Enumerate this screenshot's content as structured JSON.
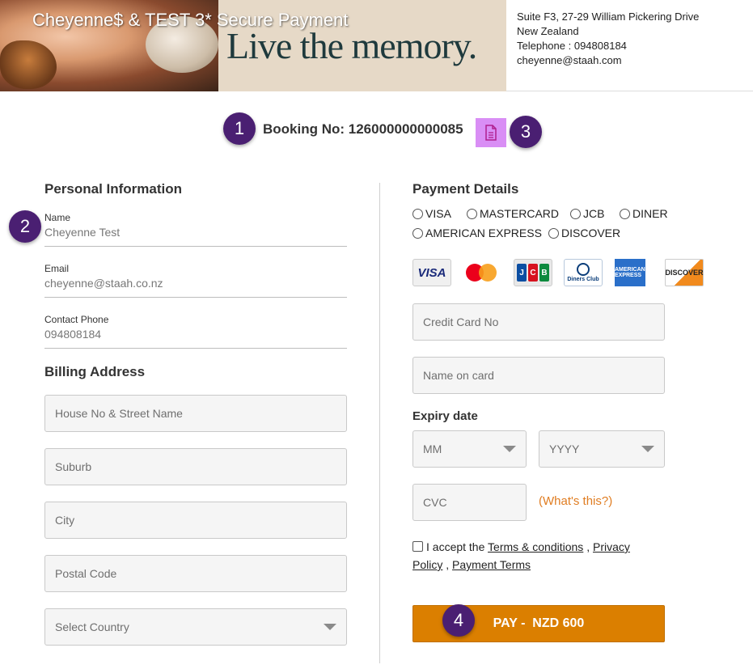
{
  "header": {
    "banner_title": "Cheyenne$ & TEST 3* Secure Payment",
    "banner_tagline": "Live the memory.",
    "address_line1": "Suite F3, 27-29 William Pickering Drive",
    "address_line2": "New Zealand",
    "telephone": "Telephone : 094808184",
    "email": "cheyenne@staah.com"
  },
  "booking": {
    "label": "Booking No: 126000000000085"
  },
  "markers": [
    "1",
    "2",
    "3",
    "4"
  ],
  "personal": {
    "title": "Personal Information",
    "name_label": "Name",
    "name_value": "Cheyenne Test",
    "email_label": "Email",
    "email_value": "cheyenne@staah.co.nz",
    "phone_label": "Contact Phone",
    "phone_value": "094808184"
  },
  "billing": {
    "title": "Billing Address",
    "street_placeholder": "House No & Street Name",
    "suburb_placeholder": "Suburb",
    "city_placeholder": "City",
    "postal_placeholder": "Postal Code",
    "country_placeholder": "Select Country"
  },
  "payment": {
    "title": "Payment Details",
    "card_types": [
      "VISA",
      "MASTERCARD",
      "JCB",
      "DINER",
      "AMERICAN EXPRESS",
      "DISCOVER"
    ],
    "logos": {
      "visa": "VISA",
      "jcb": [
        "J",
        "C",
        "B"
      ],
      "diners": "Diners Club",
      "amex": "AMERICAN EXPRESS",
      "discover": "DISCOVER"
    },
    "card_no_placeholder": "Credit Card No",
    "name_on_card_placeholder": "Name on card",
    "expiry_label": "Expiry date",
    "month_placeholder": "MM",
    "year_placeholder": "YYYY",
    "cvc_placeholder": "CVC",
    "whats_this": "(What's this?)",
    "terms_prefix": "I accept the",
    "terms_link": "Terms & conditions",
    "privacy_link": "Privacy Policy",
    "payment_terms_link": "Payment Terms",
    "pay_label": "PAY -  NZD 600"
  },
  "colors": {
    "marker": "#4a1f72",
    "pay_button": "#db7f00",
    "doc_button": "#d98ef5",
    "link_orange": "#e07d22"
  },
  "icons": {
    "document": "document-icon",
    "dropdown": "chevron-down-icon"
  }
}
